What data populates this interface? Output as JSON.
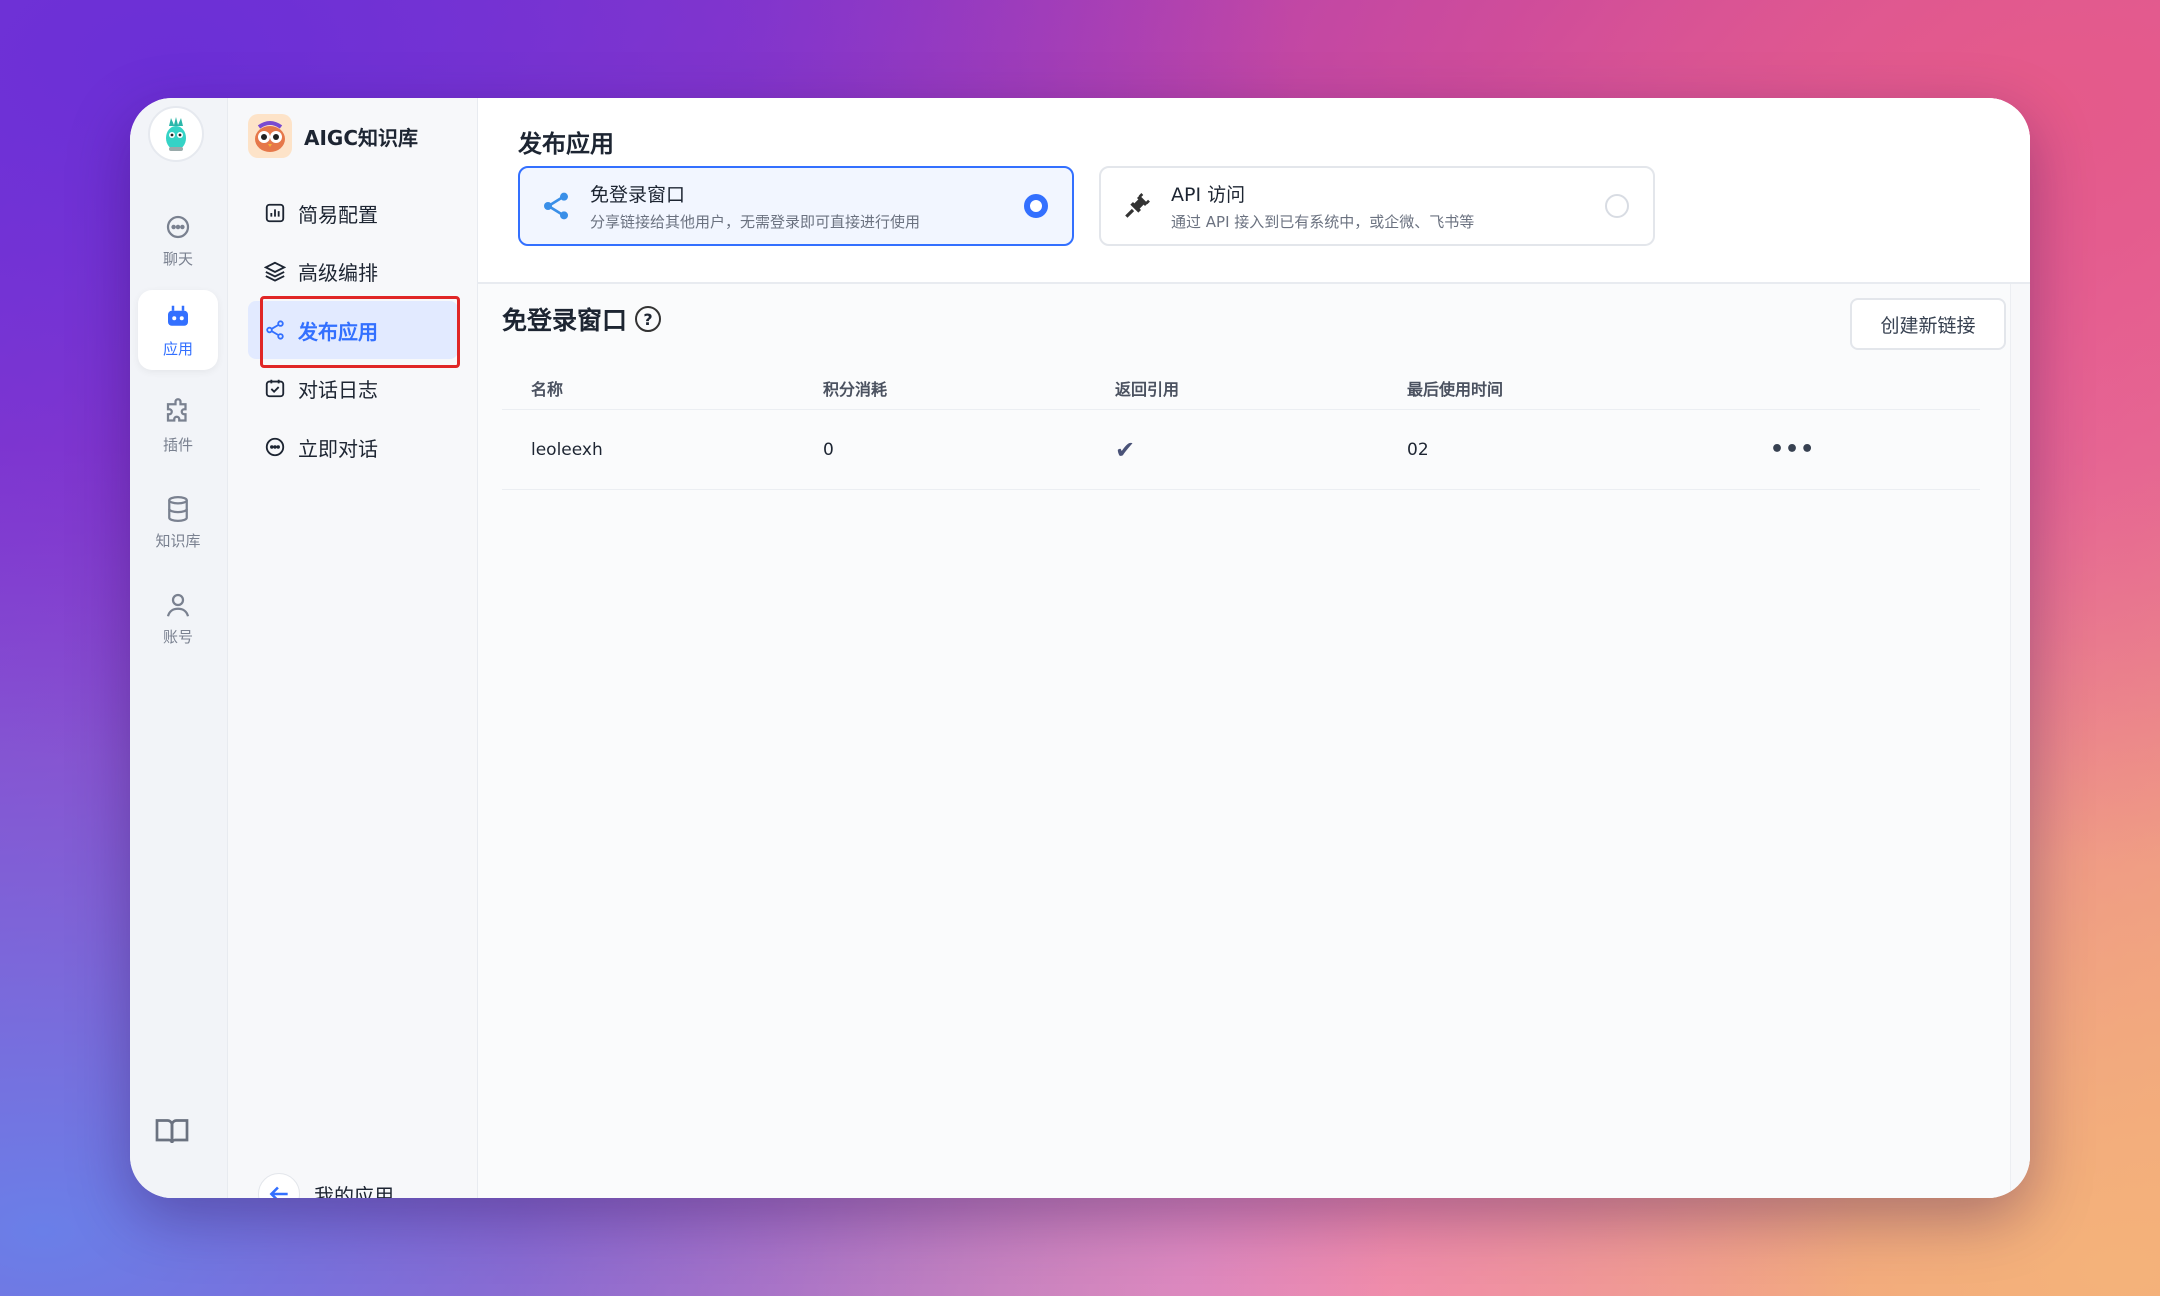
{
  "rail": {
    "items": [
      {
        "label": "聊天",
        "icon": "chat-icon"
      },
      {
        "label": "应用",
        "icon": "robot-icon",
        "active": true
      },
      {
        "label": "插件",
        "icon": "puzzle-icon"
      },
      {
        "label": "知识库",
        "icon": "database-icon"
      },
      {
        "label": "账号",
        "icon": "user-icon"
      }
    ]
  },
  "sidebar": {
    "app_name": "AIGC知识库",
    "items": [
      {
        "label": "简易配置",
        "icon": "chart-icon"
      },
      {
        "label": "高级编排",
        "icon": "layers-icon"
      },
      {
        "label": "发布应用",
        "icon": "share-icon",
        "active": true
      },
      {
        "label": "对话日志",
        "icon": "calendar-icon"
      },
      {
        "label": "立即对话",
        "icon": "chat-bubble-icon"
      }
    ],
    "back_label": "我的应用"
  },
  "main": {
    "title": "发布应用",
    "cards": [
      {
        "title": "免登录窗口",
        "desc": "分享链接给其他用户，无需登录即可直接进行使用",
        "selected": true
      },
      {
        "title": "API 访问",
        "desc": "通过 API 接入到已有系统中，或企微、飞书等",
        "selected": false
      }
    ],
    "section_title": "免登录窗口",
    "create_button": "创建新链接",
    "table": {
      "headers": [
        "名称",
        "积分消耗",
        "返回引用",
        "最后使用时间"
      ],
      "rows": [
        {
          "name": "leoleexh",
          "points": "0",
          "return_ref": "✔",
          "last_used": "02"
        }
      ]
    }
  },
  "colors": {
    "accent": "#3370ff",
    "highlight": "#e02626"
  }
}
